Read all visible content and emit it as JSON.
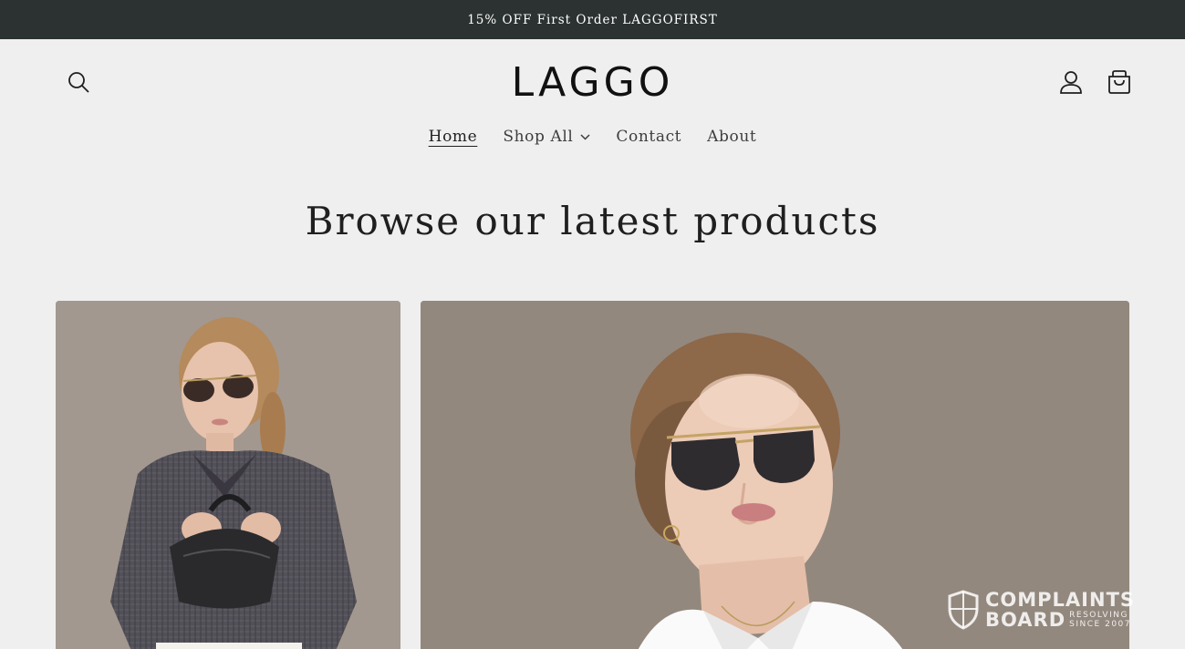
{
  "announcement": {
    "text": "15% OFF First Order LAGGOFIRST"
  },
  "header": {
    "logo": "LAGGO",
    "search_icon": "search-icon",
    "account_icon": "user-icon",
    "cart_icon": "cart-icon"
  },
  "nav": {
    "items": [
      {
        "label": "Home",
        "active": true
      },
      {
        "label": "Shop All",
        "has_dropdown": true
      },
      {
        "label": "Contact"
      },
      {
        "label": "About"
      }
    ]
  },
  "main": {
    "heading": "Browse our latest products"
  },
  "watermark": {
    "line1": "COMPLAINTS",
    "line2": "BOARD",
    "small1": "RESOLVING",
    "small2": "SINCE 2007"
  },
  "colors": {
    "announcement_bg": "#2b3231",
    "page_bg": "#efefef",
    "text": "#1f1f1f"
  }
}
